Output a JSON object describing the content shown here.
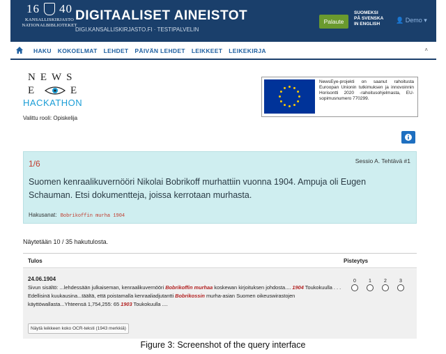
{
  "header": {
    "logo_year_left": "16",
    "logo_year_right": "40",
    "logo_name_line1": "KANSALLISKIRJASTO",
    "logo_name_line2": "NATIONALBIBLIOTEKET",
    "title": "DIGITAALISET AINEISTOT",
    "subtitle": "DIGI.KANSALLISKIRJASTO.FI  ·  TESTIPALVELIN",
    "feedback_label": "Palaute",
    "lang_line1": "SUOMEKSI",
    "lang_line2": "PÅ SVENSKA",
    "lang_line3": "IN ENGLISH",
    "user_label": "Demo",
    "colors": {
      "header_bg": "#1a3f6b",
      "feedback_bg": "#6a9a2e"
    }
  },
  "nav": {
    "home_icon": "home-icon",
    "items": [
      "HAKU",
      "KOKOELMAT",
      "LEHDET",
      "PÄIVÄN LEHDET",
      "LEIKKEET",
      "LEIKEKIRJA"
    ],
    "collapse_icon": "chevron-up-icon"
  },
  "brand": {
    "news": "NEWS",
    "eye_left": "E",
    "eye_right": "E",
    "hackathon": "HACKATHON",
    "role": "Valittu rooli: Opiskelija"
  },
  "eu": {
    "text": "NewsEye-projekti on saanut rahoitusta Euroopan Unionin tutkimuksen ja innovoinnin Horisontti 2020 -rahoitusohjelmasta, EU-sopimusnumero 770299."
  },
  "task": {
    "number": "1/6",
    "session": "Sessio A. Tehtävä #1",
    "question": "Suomen kenraalikuvernööri Nikolai Bobrikoff murhattiin vuonna 1904. Ampuja oli Eugen Schauman. Etsi dokumentteja, joissa kerrotaan murhasta.",
    "search_label": "Hakusanat:",
    "search_terms": "Bobrikoffin murha 1904"
  },
  "results": {
    "count_text": "Näytetään 10 / 35 hakutulosta.",
    "col_result": "Tulos",
    "col_score": "Pisteytys",
    "rows": [
      {
        "date": "24.06.1904",
        "s1": "Sivun sisältö: ...lehdessään julkaiseman, kenraalikuvernööri ",
        "h1": "Bobrikoffin murhaa",
        "s2": " koskewan kirjoituksen johdosta.... ",
        "h2": "1904",
        "s3": " Toukokuulla . . . Edellisinä kuukausina...täältä, että poistamalla kenraaliadjutantti ",
        "h3": "Bobrikossin",
        "s4": " murha-asian Suomen oikeuswirastojen käyttöwallasta...Yhteensä 1,754,255: 65 ",
        "h4": "1903",
        "s5": " Toukokuulla ....",
        "ocr_button": "Näytä leikkeen koko OCR-teksti (1943 merkkiä)"
      }
    ],
    "score_options": [
      "0",
      "1",
      "2",
      "3"
    ]
  },
  "caption": "Figure 3: Screenshot of the query interface"
}
